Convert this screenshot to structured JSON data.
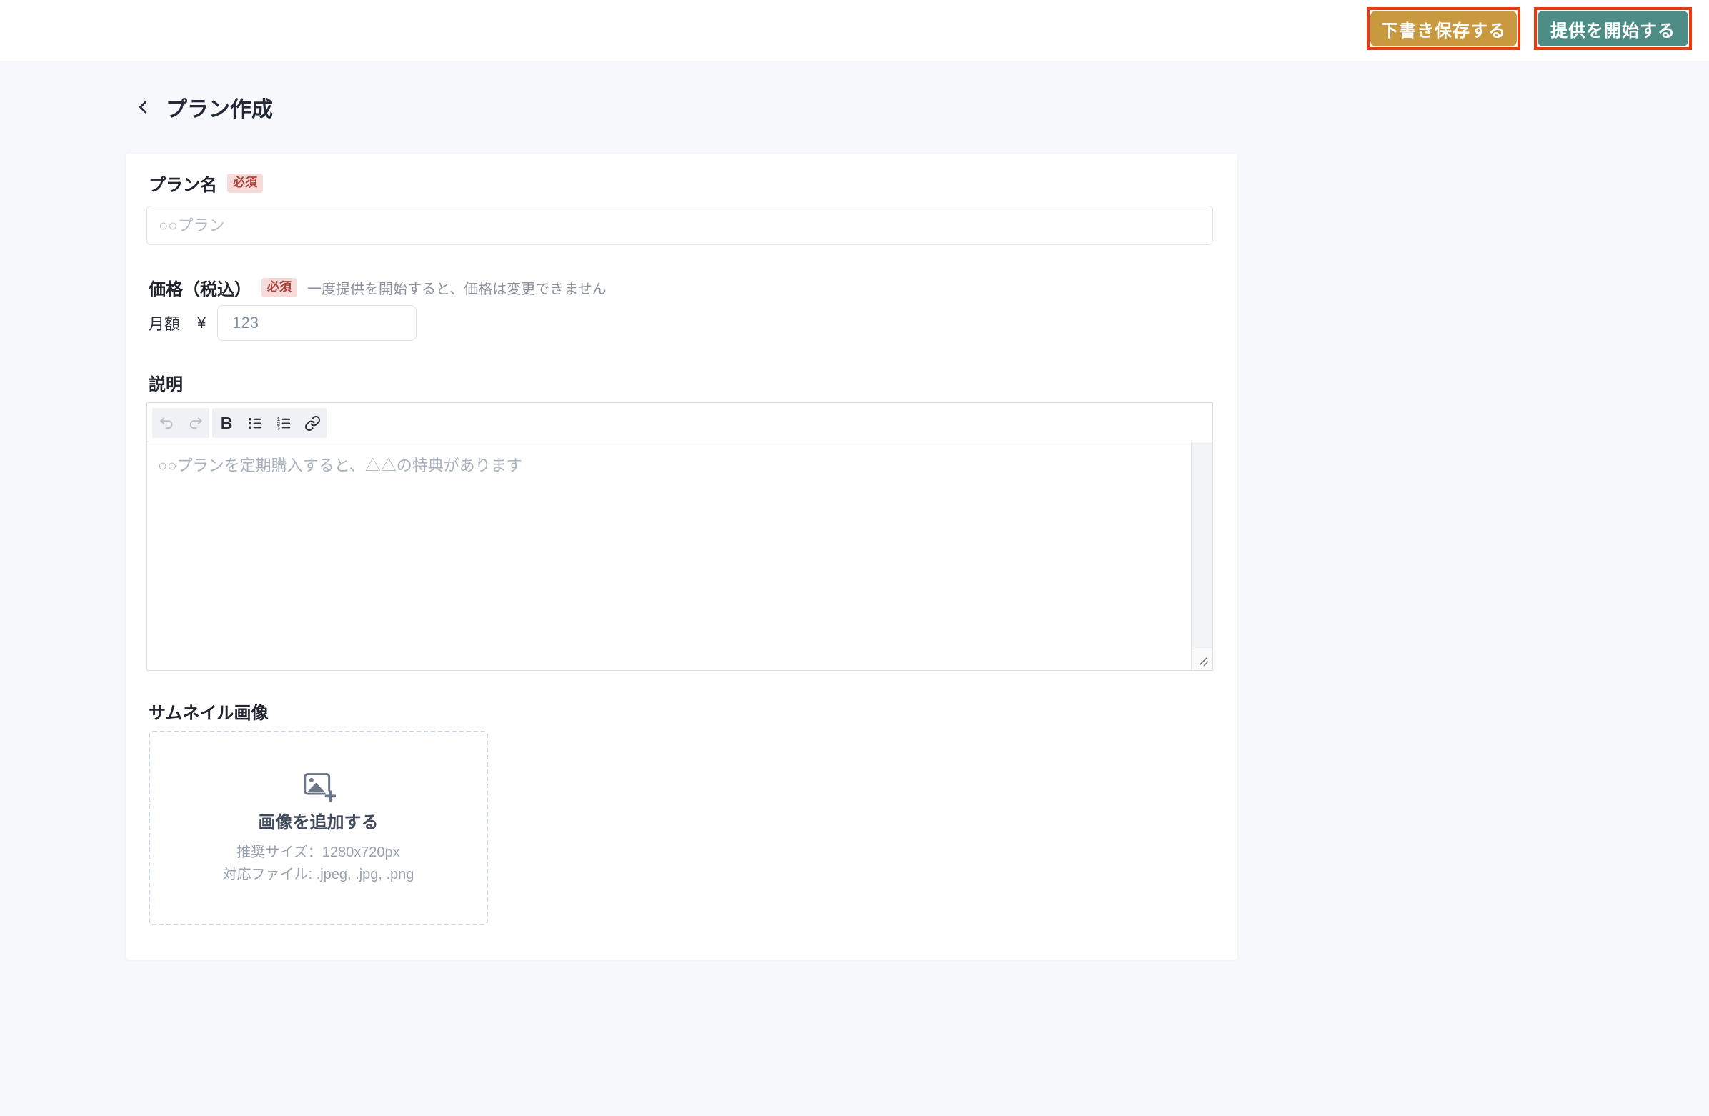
{
  "colors": {
    "page_background": "#F7F8FB",
    "card_background": "#FFFFFF",
    "accent_gold": "#C8993F",
    "accent_teal": "#4E8D86",
    "annotation_red": "#EB3A10",
    "badge_bg": "#F6DBDA",
    "badge_text": "#AE4038",
    "text_dark": "#232936",
    "text_muted": "#8B919C"
  },
  "header": {
    "save_draft_label": "下書き保存する",
    "start_label": "提供を開始する"
  },
  "page_title": {
    "title": "プラン作成"
  },
  "plan_name": {
    "label": "プラン名",
    "required": "必須",
    "placeholder": "○○プラン",
    "value": ""
  },
  "price": {
    "label": "価格（税込）",
    "required": "必須",
    "note": "一度提供を開始すると、価格は変更できません",
    "period_label": "月額",
    "currency": "¥",
    "placeholder": "123",
    "value": ""
  },
  "description": {
    "label": "説明",
    "placeholder": "○○プランを定期購入すると、△△の特典があります",
    "toolbar": {
      "bold": "B",
      "ol_numbers": [
        "1",
        "2",
        "3"
      ]
    }
  },
  "thumbnail": {
    "label": "サムネイル画像",
    "add_label": "画像を追加する",
    "size_hint": "推奨サイズ：1280x720px",
    "file_hint": "対応ファイル: .jpeg, .jpg, .png"
  }
}
